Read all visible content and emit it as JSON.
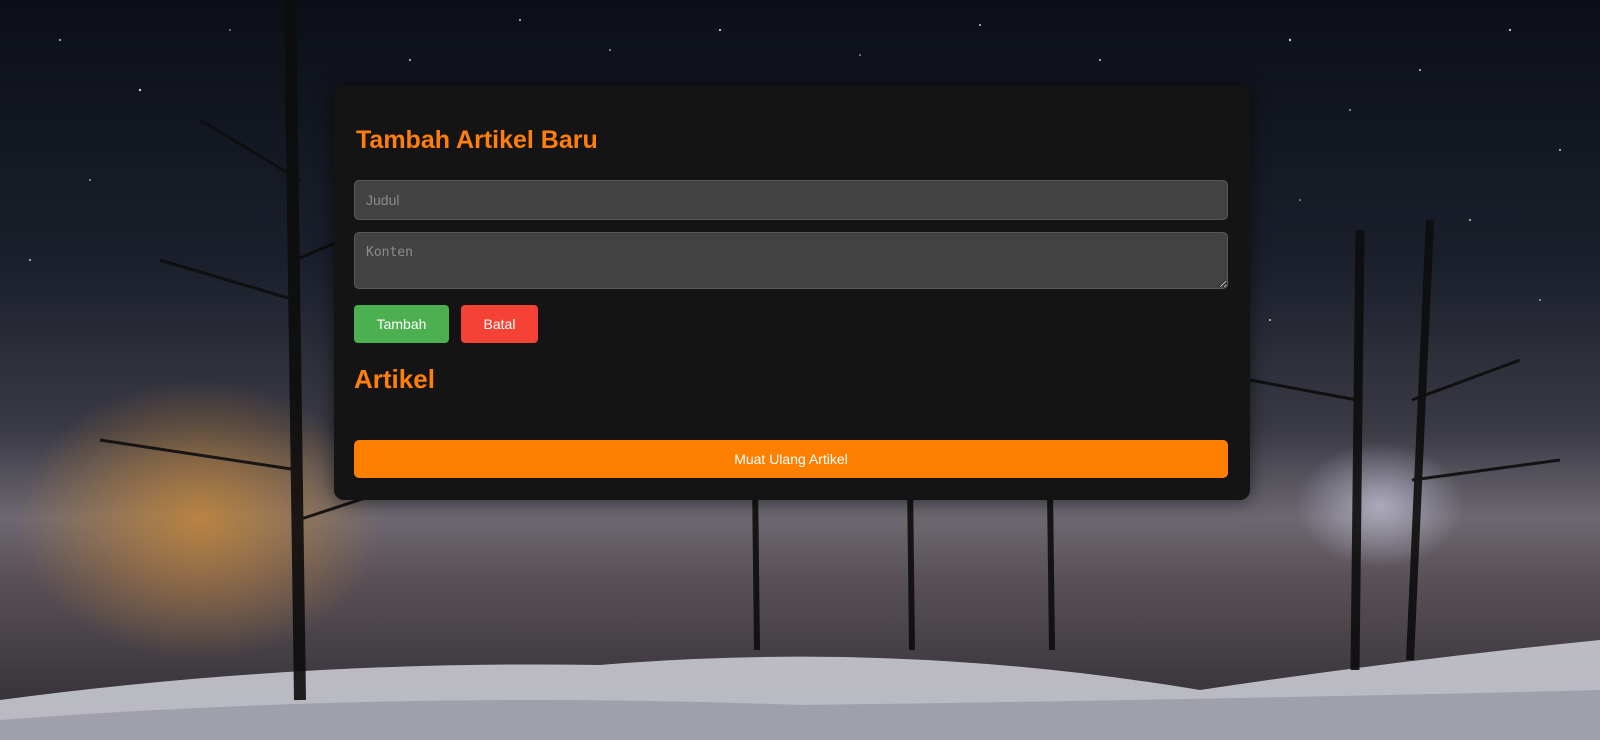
{
  "form": {
    "heading": "Tambah Artikel Baru",
    "title_placeholder": "Judul",
    "content_placeholder": "Konten",
    "add_label": "Tambah",
    "cancel_label": "Batal"
  },
  "articles": {
    "heading": "Artikel",
    "reload_label": "Muat Ulang Artikel"
  },
  "colors": {
    "accent": "#ff7f0a",
    "add_button": "#4caf50",
    "cancel_button": "#f44336",
    "reload_button": "#ff7f00",
    "card_background": "#141414"
  }
}
